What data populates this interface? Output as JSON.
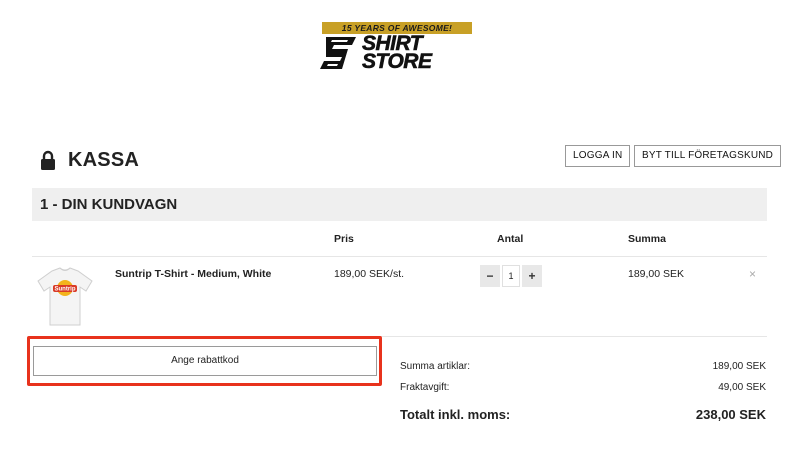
{
  "logo": {
    "banner": "15 YEARS OF AWESOME!",
    "word1": "SHIRT",
    "word2": "STORE",
    "banner_color": "#c8a026"
  },
  "header": {
    "title": "KASSA",
    "lock_icon": "lock-icon",
    "login_label": "LOGGA IN",
    "company_label": "BYT TILL FÖRETAGSKUND"
  },
  "cart": {
    "section_title": "1 - DIN KUNDVAGN",
    "columns": {
      "price": "Pris",
      "qty": "Antal",
      "sum": "Summa"
    },
    "items": [
      {
        "name": "Suntrip T-Shirt - Medium, White",
        "price": "189,00 SEK/st.",
        "quantity": "1",
        "minus": "−",
        "plus": "+",
        "sum": "189,00 SEK",
        "remove": "×",
        "shirt_print": "Suntrip"
      }
    ]
  },
  "discount": {
    "label": "Ange rabattkod",
    "highlight_color": "#e8321c"
  },
  "summary": {
    "items_label": "Summa artiklar:",
    "items_value": "189,00 SEK",
    "shipping_label": "Fraktavgift:",
    "shipping_value": "49,00 SEK",
    "total_label": "Totalt inkl. moms:",
    "total_value": "238,00 SEK"
  }
}
